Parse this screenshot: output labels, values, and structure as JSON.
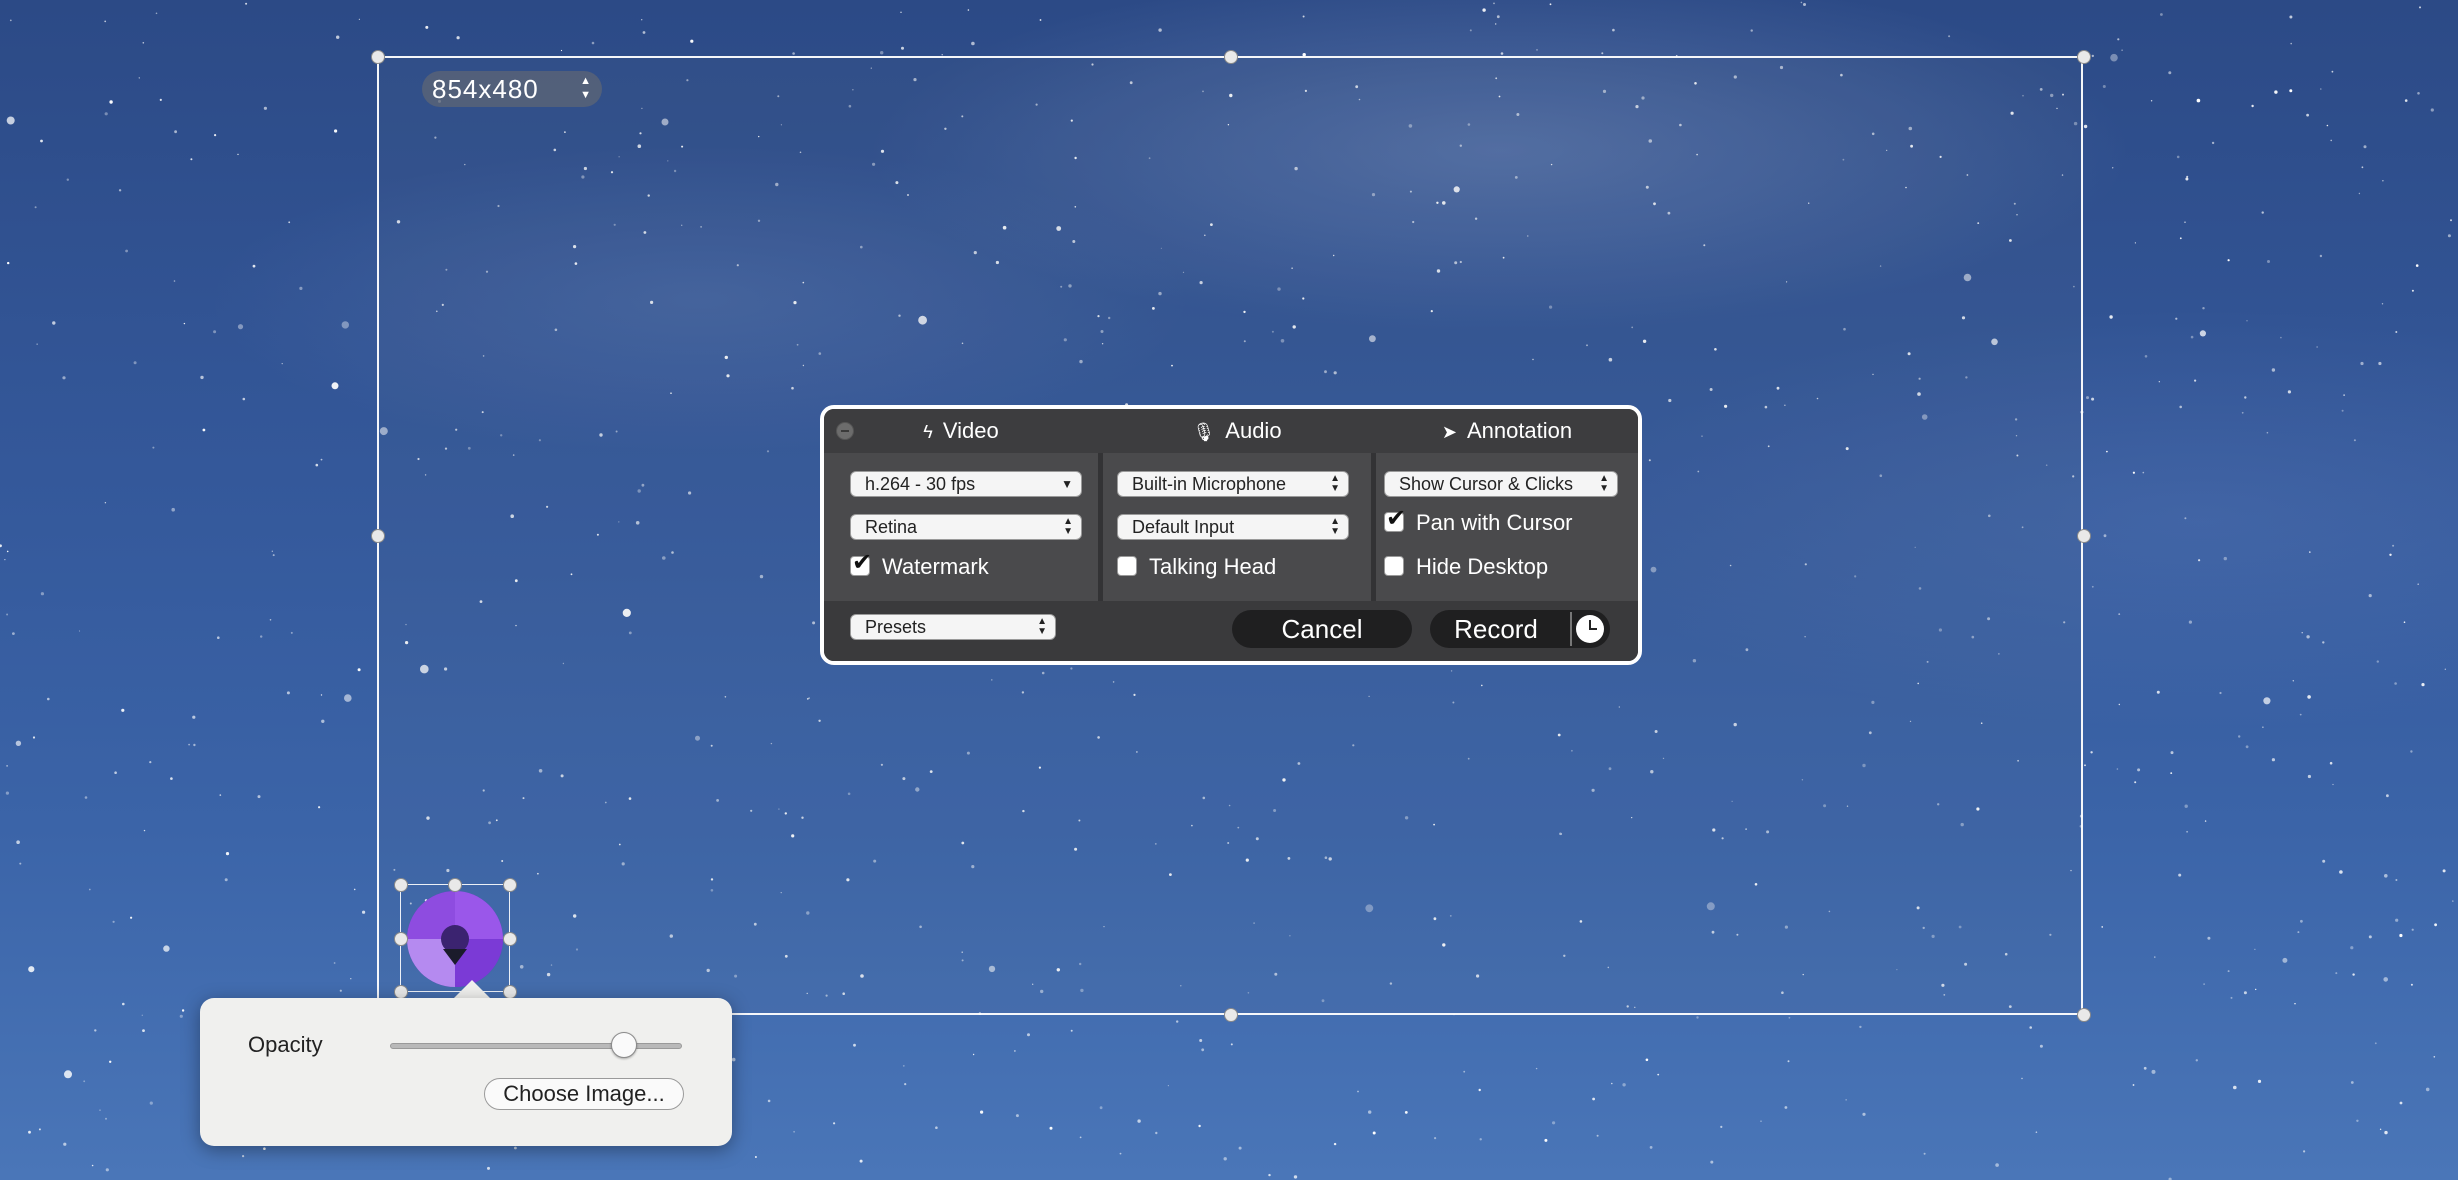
{
  "capture": {
    "resolution_label": "854x480"
  },
  "panel": {
    "tabs": [
      {
        "label": "Video",
        "icon": "bolt-icon"
      },
      {
        "label": "Audio",
        "icon": "microphone-icon"
      },
      {
        "label": "Annotation",
        "icon": "cursor-icon"
      }
    ],
    "video": {
      "codec_value": "h.264 - 30 fps",
      "scale_value": "Retina",
      "watermark_label": "Watermark",
      "watermark_checked": true
    },
    "audio": {
      "input_value": "Built-in Microphone",
      "output_value": "Default Input",
      "talking_head_label": "Talking Head",
      "talking_head_checked": false
    },
    "annotation": {
      "cursor_value": "Show Cursor & Clicks",
      "pan_label": "Pan with Cursor",
      "pan_checked": true,
      "hide_desktop_label": "Hide Desktop",
      "hide_desktop_checked": false
    },
    "presets_value": "Presets",
    "cancel_label": "Cancel",
    "record_label": "Record"
  },
  "watermark_popover": {
    "opacity_label": "Opacity",
    "opacity_value": 0.8,
    "choose_image_label": "Choose Image..."
  },
  "colors": {
    "panel_bg": "#3a3a3c",
    "logo_purple": "#8a3fd8"
  }
}
